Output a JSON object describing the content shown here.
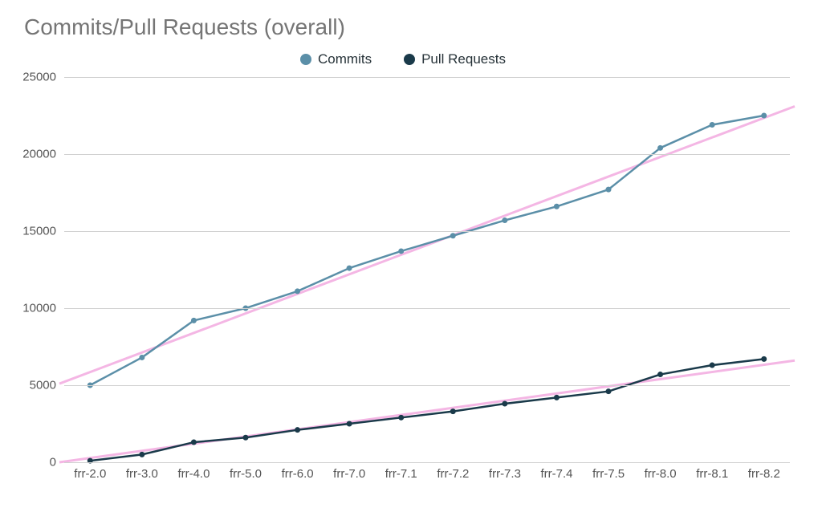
{
  "chart_data": {
    "type": "line",
    "title": "Commits/Pull Requests (overall)",
    "categories": [
      "frr-2.0",
      "frr-3.0",
      "frr-4.0",
      "frr-5.0",
      "frr-6.0",
      "frr-7.0",
      "frr-7.1",
      "frr-7.2",
      "frr-7.3",
      "frr-7.4",
      "frr-7.5",
      "frr-8.0",
      "frr-8.1",
      "frr-8.2"
    ],
    "series": [
      {
        "name": "Commits",
        "color": "#5b8fa8",
        "values": [
          5000,
          6800,
          9200,
          10000,
          11100,
          12600,
          13700,
          14700,
          15700,
          16600,
          17700,
          20400,
          21900,
          22500
        ]
      },
      {
        "name": "Pull Requests",
        "color": "#1a3a4a",
        "values": [
          100,
          500,
          1300,
          1600,
          2100,
          2500,
          2900,
          3300,
          3800,
          4200,
          4600,
          5700,
          6300,
          6700
        ]
      }
    ],
    "trendlines": [
      {
        "for": "Commits",
        "color": "#f4b6e4",
        "start": 5100,
        "end": 23100
      },
      {
        "for": "Pull Requests",
        "color": "#f4b6e4",
        "start": 0,
        "end": 6600
      }
    ],
    "ylabel": "",
    "xlabel": "",
    "y_ticks": [
      0,
      5000,
      10000,
      15000,
      20000,
      25000
    ],
    "ylim": [
      0,
      25000
    ],
    "legend_position": "top"
  }
}
